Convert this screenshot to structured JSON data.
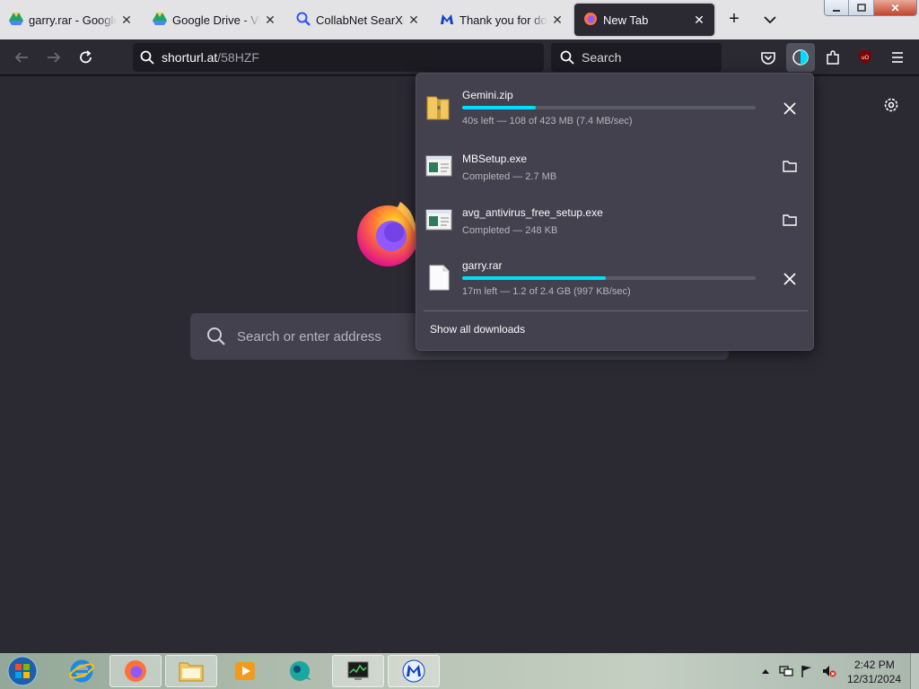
{
  "tabs": [
    {
      "title": "garry.rar - Google Drive",
      "icon": "google-drive-icon"
    },
    {
      "title": "Google Drive - Virus scan warning",
      "icon": "google-drive-icon"
    },
    {
      "title": "CollabNet SearXNG",
      "icon": "search-icon"
    },
    {
      "title": "Thank you for downloading",
      "icon": "malwarebytes-icon"
    },
    {
      "title": "New Tab",
      "icon": "firefox-icon"
    }
  ],
  "navbar": {
    "url_host": "shorturl.at",
    "url_path": "/58HZF",
    "search_placeholder": "Search"
  },
  "home": {
    "search_placeholder": "Search or enter address"
  },
  "downloads": {
    "items": [
      {
        "name": "Gemini.zip",
        "status": "40s left — 108 of 423 MB (7.4 MB/sec)",
        "progress": 0.25,
        "icon": "zip-folder-icon",
        "action": "cancel-icon"
      },
      {
        "name": "MBSetup.exe",
        "status": "Completed — 2.7 MB",
        "progress": null,
        "icon": "exe-icon",
        "action": "folder-icon"
      },
      {
        "name": "avg_antivirus_free_setup.exe",
        "status": "Completed — 248 KB",
        "progress": null,
        "icon": "exe-icon",
        "action": "folder-icon"
      },
      {
        "name": "garry.rar",
        "status": "17m left — 1.2 of 2.4 GB (997 KB/sec)",
        "progress": 0.49,
        "icon": "file-icon",
        "action": "cancel-icon"
      }
    ],
    "show_all_label": "Show all downloads"
  },
  "taskbar": {
    "time": "2:42 PM",
    "date": "12/31/2024",
    "apps": [
      "internet-explorer-icon",
      "firefox-icon",
      "file-explorer-icon",
      "media-player-icon",
      "messenger-icon",
      "task-manager-icon",
      "malwarebytes-icon"
    ]
  },
  "colors": {
    "accent": "#00ddff",
    "panel_bg": "#42414d",
    "content_bg": "#2b2a33"
  }
}
